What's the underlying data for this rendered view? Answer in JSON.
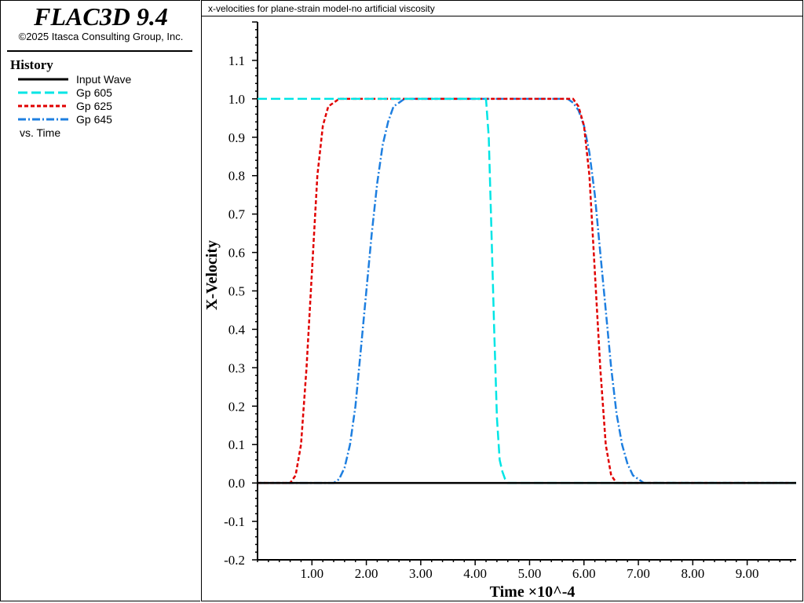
{
  "sidebar": {
    "app_title": "FLAC3D 9.4",
    "copyright": "©2025 Itasca Consulting Group, Inc.",
    "history_heading": "History",
    "legend": [
      {
        "label": "Input Wave",
        "color": "#000000",
        "dash": "solid"
      },
      {
        "label": "Gp 605",
        "color": "#00e5e5",
        "dash": "long-dash"
      },
      {
        "label": "Gp 625",
        "color": "#e00000",
        "dash": "short-dash"
      },
      {
        "label": "Gp 645",
        "color": "#1e7fe0",
        "dash": "dash-dot"
      }
    ],
    "vs_label": "vs. Time"
  },
  "plot": {
    "title": "x-velocities for plane-strain model-no artificial viscosity"
  },
  "chart_data": {
    "type": "line",
    "title": "x-velocities for plane-strain model-no artificial viscosity",
    "xlabel": "Time ×10^-4",
    "ylabel": "X-Velocity",
    "xlim": [
      0,
      9.9
    ],
    "ylim": [
      -0.2,
      1.2
    ],
    "x_ticks": [
      "1.00",
      "2.00",
      "3.00",
      "4.00",
      "5.00",
      "6.00",
      "7.00",
      "8.00",
      "9.00"
    ],
    "y_ticks": [
      "-0.2",
      "-0.1",
      "0.0",
      "0.1",
      "0.2",
      "0.3",
      "0.4",
      "0.5",
      "0.6",
      "0.7",
      "0.8",
      "0.9",
      "1.0",
      "1.1"
    ],
    "grid": false,
    "legend_position": "left-panel",
    "series": [
      {
        "name": "Input Wave",
        "color": "#000000",
        "dash": "solid",
        "x": [
          0,
          9.9
        ],
        "y": [
          0,
          0
        ]
      },
      {
        "name": "Gp 605",
        "color": "#00e5e5",
        "dash": "long-dash",
        "x": [
          0,
          4.2,
          4.25,
          4.3,
          4.35,
          4.4,
          4.45,
          4.5,
          4.55,
          4.6,
          4.7,
          9.9
        ],
        "y": [
          1.0,
          1.0,
          0.9,
          0.65,
          0.4,
          0.17,
          0.06,
          0.03,
          0.01,
          0.0,
          0.0,
          0.0
        ]
      },
      {
        "name": "Gp 625",
        "color": "#e00000",
        "dash": "short-dash",
        "x": [
          0,
          0.6,
          0.7,
          0.8,
          0.9,
          1.0,
          1.1,
          1.2,
          1.3,
          1.4,
          1.5,
          1.6,
          1.7,
          1.8,
          5.7,
          5.8,
          5.9,
          6.0,
          6.1,
          6.2,
          6.3,
          6.4,
          6.5,
          6.6,
          6.7,
          6.8,
          6.9,
          9.9
        ],
        "y": [
          0.0,
          0.0,
          0.02,
          0.1,
          0.3,
          0.55,
          0.8,
          0.93,
          0.98,
          0.99,
          1.0,
          1.0,
          1.0,
          1.0,
          1.0,
          1.0,
          0.98,
          0.93,
          0.8,
          0.55,
          0.3,
          0.1,
          0.02,
          0.0,
          0.0,
          0.0,
          0.0,
          0.0
        ]
      },
      {
        "name": "Gp 645",
        "color": "#1e7fe0",
        "dash": "dash-dot",
        "x": [
          0,
          1.4,
          1.5,
          1.6,
          1.7,
          1.8,
          1.9,
          2.0,
          2.1,
          2.2,
          2.3,
          2.4,
          2.5,
          2.6,
          2.7,
          2.8,
          2.9,
          3.0,
          5.7,
          5.8,
          5.9,
          6.0,
          6.1,
          6.2,
          6.3,
          6.4,
          6.5,
          6.6,
          6.7,
          6.8,
          6.9,
          7.0,
          7.1,
          7.2,
          7.3,
          9.9
        ],
        "y": [
          0.0,
          0.0,
          0.01,
          0.04,
          0.1,
          0.2,
          0.35,
          0.5,
          0.65,
          0.78,
          0.88,
          0.94,
          0.98,
          0.99,
          1.0,
          1.0,
          1.0,
          1.0,
          1.0,
          0.99,
          0.97,
          0.93,
          0.86,
          0.75,
          0.6,
          0.45,
          0.3,
          0.18,
          0.1,
          0.05,
          0.02,
          0.01,
          0.0,
          0.0,
          0.0,
          0.0
        ]
      }
    ]
  }
}
